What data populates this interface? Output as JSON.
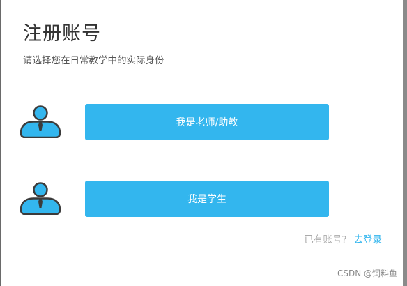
{
  "page": {
    "title": "注册账号",
    "subtitle": "请选择您在日常教学中的实际身份"
  },
  "roles": [
    {
      "icon": "user-tie-icon",
      "label": "我是老师/助教"
    },
    {
      "icon": "user-tie-icon",
      "label": "我是学生"
    }
  ],
  "footer": {
    "prompt": "已有账号?",
    "login_link": "去登录"
  },
  "watermark": "CSDN @饲料鱼",
  "colors": {
    "accent": "#33b6ee",
    "icon_outline": "#3b3b3b",
    "title_text": "#333333",
    "muted_text": "#aaaaaa"
  }
}
